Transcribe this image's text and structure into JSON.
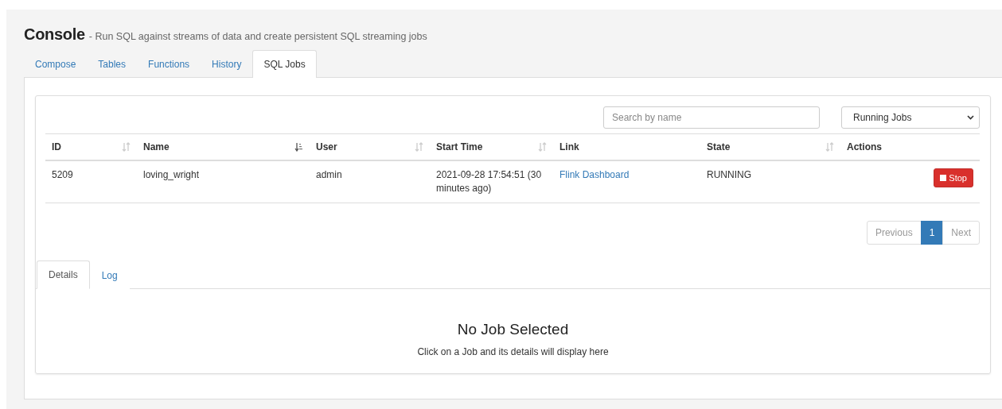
{
  "header": {
    "title": "Console",
    "subtitle": "- Run SQL against streams of data and create persistent SQL streaming jobs"
  },
  "tabs": [
    {
      "label": "Compose",
      "selected": false
    },
    {
      "label": "Tables",
      "selected": false
    },
    {
      "label": "Functions",
      "selected": false
    },
    {
      "label": "History",
      "selected": false
    },
    {
      "label": "SQL Jobs",
      "selected": true
    }
  ],
  "search": {
    "placeholder": "Search by name"
  },
  "filter": {
    "value": "Running Jobs"
  },
  "table": {
    "columns": [
      {
        "label": "ID",
        "sortable": true,
        "sorted": false
      },
      {
        "label": "Name",
        "sortable": true,
        "sorted": true
      },
      {
        "label": "User",
        "sortable": true,
        "sorted": false
      },
      {
        "label": "Start Time",
        "sortable": true,
        "sorted": false
      },
      {
        "label": "Link",
        "sortable": false
      },
      {
        "label": "State",
        "sortable": true,
        "sorted": false
      },
      {
        "label": "Actions",
        "sortable": false
      }
    ],
    "rows": [
      {
        "id": "5209",
        "name": "loving_wright",
        "user": "admin",
        "start_time": "2021-09-28 17:54:51 (30 minutes ago)",
        "link": "Flink Dashboard",
        "state": "RUNNING",
        "action": "Stop"
      }
    ]
  },
  "pagination": {
    "previous": "Previous",
    "pages": [
      {
        "label": "1",
        "selected": true
      }
    ],
    "next": "Next"
  },
  "detail_tabs": [
    {
      "label": "Details",
      "selected": true
    },
    {
      "label": "Log",
      "selected": false
    }
  ],
  "details": {
    "title": "No Job Selected",
    "message": "Click on a Job and its details will display here"
  }
}
